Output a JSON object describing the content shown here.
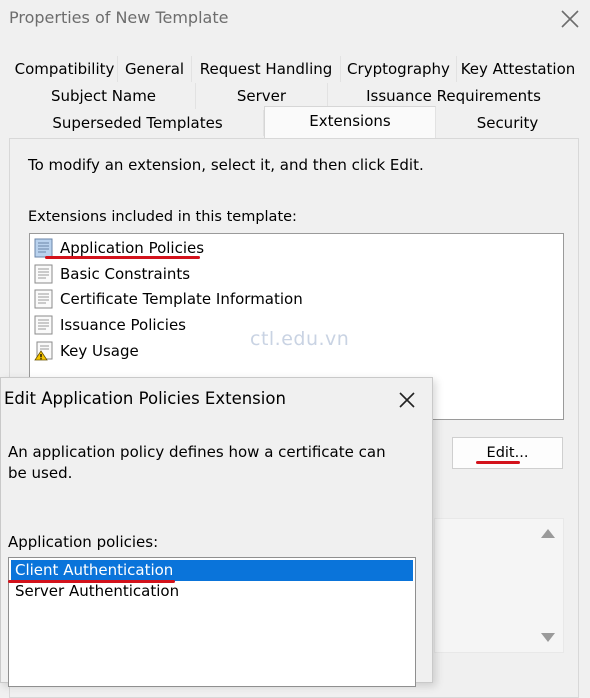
{
  "window": {
    "title": "Properties of New Template"
  },
  "tabs": {
    "row1": [
      "Compatibility",
      "General",
      "Request Handling",
      "Cryptography",
      "Key Attestation"
    ],
    "row2": [
      "Subject Name",
      "Server",
      "Issuance Requirements"
    ],
    "row3": [
      "Superseded Templates",
      "Extensions",
      "Security"
    ],
    "active": "Extensions"
  },
  "extensions_tab": {
    "instruction": "To modify an extension, select it, and then click Edit.",
    "list_label": "Extensions included in this template:",
    "items": [
      {
        "label": "Application Policies",
        "icon": "certificate-doc-icon"
      },
      {
        "label": "Basic Constraints",
        "icon": "certificate-doc-icon"
      },
      {
        "label": "Certificate Template Information",
        "icon": "certificate-doc-icon"
      },
      {
        "label": "Issuance Policies",
        "icon": "certificate-doc-icon"
      },
      {
        "label": "Key Usage",
        "icon": "warning-doc-icon"
      }
    ],
    "edit_button": "Edit..."
  },
  "watermark": "ctl.edu.vn",
  "edit_dialog": {
    "title": "Edit Application Policies Extension",
    "description": "An application policy defines how a certificate can be used.",
    "policies_label": "Application policies:",
    "policies": [
      "Client Authentication",
      "Server Authentication"
    ],
    "selected_policy": "Client Authentication"
  },
  "colors": {
    "selection": "#0a74da",
    "annotation_underline": "#d3121b",
    "window_bg": "#f0f0f0"
  }
}
